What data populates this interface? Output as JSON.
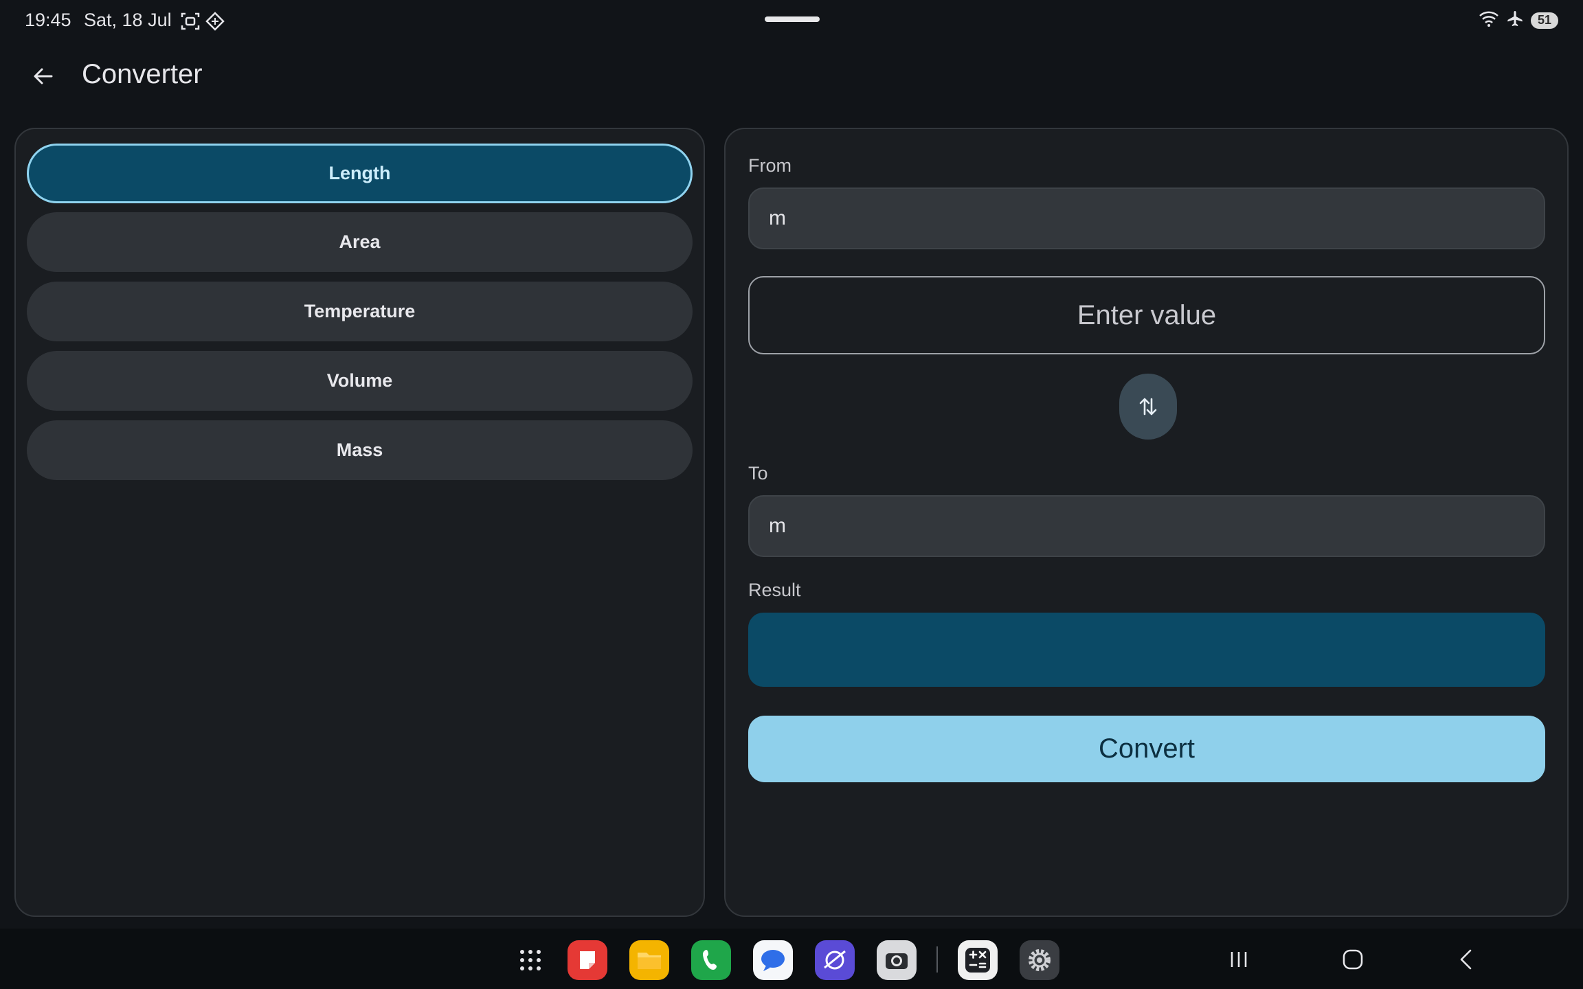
{
  "status_bar": {
    "time": "19:45",
    "date": "Sat, 18 Jul",
    "left_icons": [
      "screenshot-icon",
      "sync-icon"
    ],
    "right_icons": [
      "wifi-icon",
      "airplane-icon"
    ],
    "battery": "51"
  },
  "app_bar": {
    "title": "Converter",
    "back_icon": "arrow-back-icon"
  },
  "categories": [
    {
      "label": "Length",
      "selected": true
    },
    {
      "label": "Area",
      "selected": false
    },
    {
      "label": "Temperature",
      "selected": false
    },
    {
      "label": "Volume",
      "selected": false
    },
    {
      "label": "Mass",
      "selected": false
    }
  ],
  "converter": {
    "from_label": "From",
    "from_unit": "m",
    "value_placeholder": "Enter value",
    "value": "",
    "swap_icon": "swap-vertical-icon",
    "to_label": "To",
    "to_unit": "m",
    "result_label": "Result",
    "result_value": "",
    "convert_label": "Convert"
  },
  "taskbar": {
    "apps": [
      "apps-grid-icon",
      "notes-app-icon",
      "files-app-icon",
      "phone-app-icon",
      "messages-app-icon",
      "browser-app-icon",
      "camera-app-icon",
      "calculator-app-icon",
      "settings-app-icon"
    ],
    "nav": [
      "recents-icon",
      "home-icon",
      "back-icon"
    ]
  },
  "colors": {
    "background": "#111418",
    "panel": "#1a1d21",
    "selected_category": "#0b4a66",
    "selected_border": "#8fd3ef",
    "convert_button": "#8fd0eb",
    "result_box": "#0b4a66"
  }
}
